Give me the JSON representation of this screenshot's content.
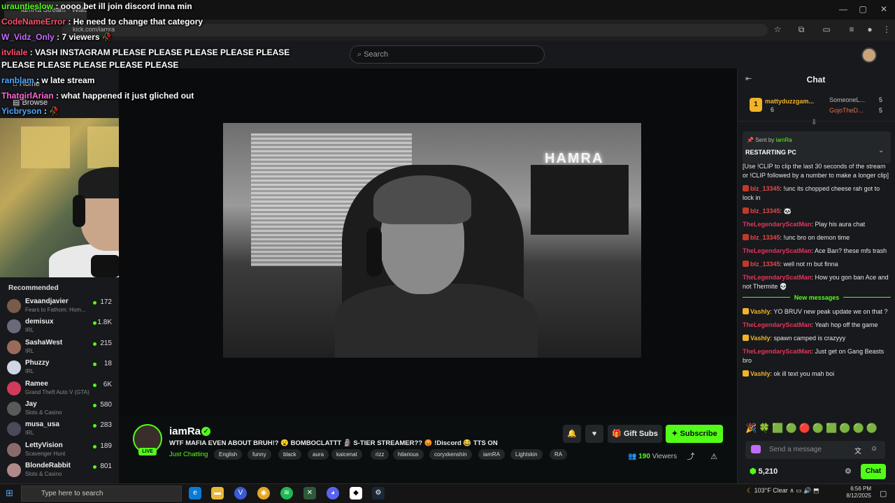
{
  "browser": {
    "tab_title": "iamRa Stream - Watch Live",
    "url": "kick.com/iamra",
    "controls": {
      "minimize": "—",
      "maximize": "▢",
      "close": "✕"
    }
  },
  "header": {
    "search_placeholder": "Search"
  },
  "sidebar": {
    "nav": [
      {
        "label": "Home",
        "icon": "home-icon"
      },
      {
        "label": "Browse",
        "icon": "browse-icon"
      }
    ],
    "recommended_title": "Recommended",
    "recommended": [
      {
        "name": "Evaandjavier",
        "category": "Fears to Fathom: Hom...",
        "viewers": "172",
        "color": "#7a5a4a"
      },
      {
        "name": "demisux",
        "category": "IRL",
        "viewers": "1.8K",
        "color": "#6a6a7a"
      },
      {
        "name": "SashaWest",
        "category": "IRL",
        "viewers": "215",
        "color": "#9a6a5a"
      },
      {
        "name": "Phuzzy",
        "category": "IRL",
        "viewers": "18",
        "color": "#cfd7e4"
      },
      {
        "name": "Ramee",
        "category": "Grand Theft Auto V (GTA)",
        "viewers": "6K",
        "color": "#d23a5a"
      },
      {
        "name": "Jay",
        "category": "Slots & Casino",
        "viewers": "580",
        "color": "#5a5a5a"
      },
      {
        "name": "musa_usa",
        "category": "IRL",
        "viewers": "283",
        "color": "#4a4a5a"
      },
      {
        "name": "LettyVision",
        "category": "Scavenger Hunt",
        "viewers": "189",
        "color": "#8a6a6a"
      },
      {
        "name": "BlondeRabbit",
        "category": "Slots & Casino",
        "viewers": "801",
        "color": "#b08a8a"
      }
    ]
  },
  "overlay_chat": [
    {
      "user": "urauntieslow",
      "text": "oooo bet ill join discord inna min",
      "color": "#53fc18"
    },
    {
      "user": "CodeNameError",
      "text": "He need to change that category",
      "color": "#ff4d6d"
    },
    {
      "user": "W_Vidz_Only",
      "text": "7 viewers 🥀",
      "color": "#c36bff"
    },
    {
      "user": "itvliale",
      "text": "VASH INSTAGRAM PLEASE PLEASE PLEASE PLEASE PLEASE PLEASE PLEASE PLEASE PLEASE PLEASE",
      "color": "#ff4d6d"
    },
    {
      "user": "ranblam",
      "text": "w late stream",
      "color": "#4da6ff"
    },
    {
      "user": "ThatgirlArian",
      "text": "what happened it just gliched out",
      "color": "#ff6ad5"
    },
    {
      "user": "Yicbryson",
      "text": "🥀",
      "color": "#4da6ff"
    }
  ],
  "stream": {
    "streamer": "iamRa",
    "live": "LIVE",
    "title": "WTF MAFIA EVEN ABOUT BRUH!? 😮 BOMBOCLATTT 🗿 S-TIER STREAMER?? 😡 !Discord 😂 TTS ON",
    "category": "Just Chatting",
    "tags": [
      "English",
      "funny",
      "black",
      "aura",
      "kaicenat",
      "rizz",
      "hilarious",
      "coryxkenshin",
      "iamRA",
      "Lightskin",
      "RA"
    ],
    "viewers": "190",
    "viewers_label": "Viewers",
    "gift_subs": "Gift Subs",
    "subscribe": "Subscribe",
    "video_sign": "HAMRA"
  },
  "chat": {
    "title": "Chat",
    "leaderboard": [
      {
        "rank": "1",
        "name": "mattyduzzgam...",
        "count": "6"
      },
      {
        "name": "SomeoneL...",
        "count": "5"
      },
      {
        "name": "GojoTheD...",
        "count": "5"
      }
    ],
    "pinned": {
      "sent_by_label": "Sent by",
      "sender": "iamRa",
      "text": "RESTARTING PC"
    },
    "messages": [
      {
        "user": "",
        "text": "[Use !CLIP to clip the last 30 seconds of the stream or !CLIP followed by a number to make a longer clip]",
        "color": "#e6e6e6",
        "badge": ""
      },
      {
        "user": "blz_13345",
        "text": ": !unc its chopped cheese rah got to lock in",
        "color": "#e34a4a",
        "badge": "#c0392b"
      },
      {
        "user": "blz_13345",
        "text": ": 🐼",
        "color": "#e34a4a",
        "badge": "#c0392b"
      },
      {
        "user": "TheLegendaryScatMan",
        "text": ": Play his aura chat",
        "color": "#e3355d",
        "badge": ""
      },
      {
        "user": "blz_13345",
        "text": ": !unc bro on demon time",
        "color": "#e34a4a",
        "badge": "#c0392b"
      },
      {
        "user": "TheLegendaryScatMan",
        "text": ": Ace Ban? these mfs trash",
        "color": "#e3355d",
        "badge": ""
      },
      {
        "user": "blz_13345",
        "text": ": well not rn but finna",
        "color": "#e34a4a",
        "badge": "#c0392b"
      },
      {
        "user": "TheLegendaryScatMan",
        "text": ": How you gon ban Ace and not Thermite 💀",
        "color": "#e3355d",
        "badge": ""
      }
    ],
    "new_messages_label": "New messages",
    "new_messages": [
      {
        "user": "Vashly",
        "text": ": YO BRUV new peak update we on that ?",
        "color": "#f0b429",
        "badge": "#f0b429"
      },
      {
        "user": "TheLegendaryScatMan",
        "text": ": Yeah hop off the game",
        "color": "#e3355d",
        "badge": ""
      },
      {
        "user": "Vashly",
        "text": ": spawn camped is crazyyy",
        "color": "#f0b429",
        "badge": "#f0b429"
      },
      {
        "user": "TheLegendaryScatMan",
        "text": ": Just get on Gang Beasts bro",
        "color": "#e3355d",
        "badge": ""
      },
      {
        "user": "Vashly",
        "text": ": ok ill text you mah boi",
        "color": "#f0b429",
        "badge": "#f0b429"
      }
    ],
    "emotes": "🎉🍀🟩🟢🔴🟢🟩🟢🟢🟢",
    "send_placeholder": "Send a message",
    "points": "5,210",
    "chat_button": "Chat"
  },
  "taskbar": {
    "search_placeholder": "Type here to search",
    "weather": "103°F  Clear",
    "time": "6:56 PM",
    "date": "8/12/2025"
  },
  "colors": {
    "accent": "#53fc18",
    "bg": "#0b0e0f",
    "panel": "#17191c"
  }
}
